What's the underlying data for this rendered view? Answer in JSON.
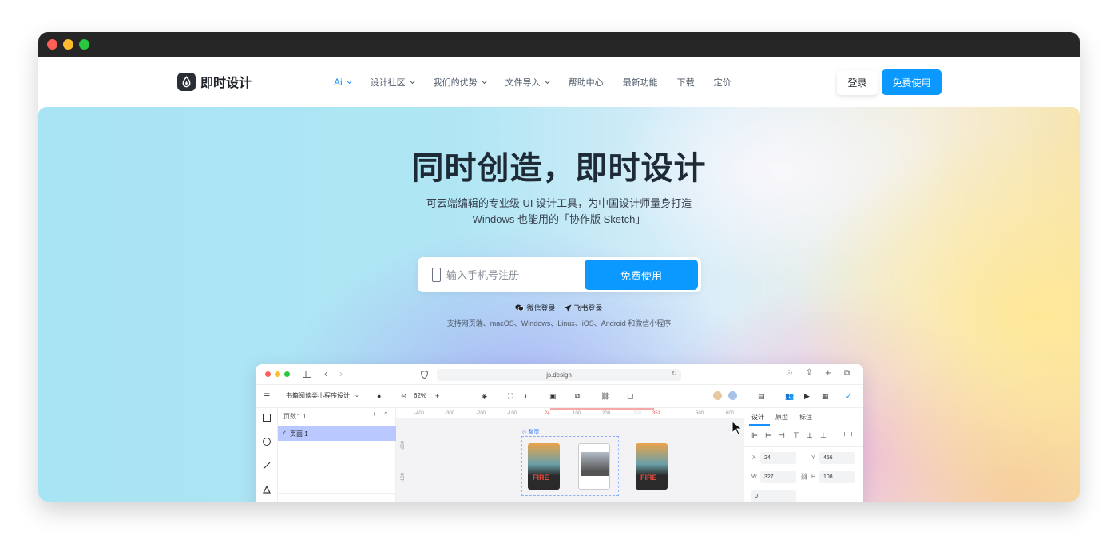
{
  "brand": {
    "name": "即时设计"
  },
  "nav": {
    "items": [
      {
        "label": "Ai",
        "dropdown": true,
        "active": true
      },
      {
        "label": "设计社区",
        "dropdown": true
      },
      {
        "label": "我们的优势",
        "dropdown": true
      },
      {
        "label": "文件导入",
        "dropdown": true
      },
      {
        "label": "帮助中心"
      },
      {
        "label": "最新功能"
      },
      {
        "label": "下载"
      },
      {
        "label": "定价"
      }
    ],
    "login_label": "登录",
    "free_label": "免费使用"
  },
  "hero": {
    "title": "同时创造，即时设计",
    "subtitle_line1": "可云端编辑的专业级 UI 设计工具，为中国设计师量身打造",
    "subtitle_line2": "Windows 也能用的「协作版 Sketch」",
    "phone_placeholder": "输入手机号注册",
    "signup_button": "免费使用",
    "wechat_login": "微信登录",
    "feishu_login": "飞书登录",
    "platforms": "支持网页端、macOS、Windows、Linux、iOS、Android 和微信小程序"
  },
  "app_preview": {
    "url": "js.design",
    "file_name": "书籍阅读类小程序设计",
    "zoom": "62%",
    "pages_label": "页数：1",
    "page_item": "页面 1",
    "frame_label": "整页",
    "ruler_ticks": [
      "-400",
      "-300",
      "-200",
      "-100",
      "24",
      "100",
      "200",
      "300",
      "351",
      "500",
      "600"
    ],
    "v_ruler": [
      "-200",
      "-100"
    ],
    "tabs": [
      "设计",
      "原型",
      "标注"
    ],
    "fields": {
      "x_label": "X",
      "x": "24",
      "y_label": "Y",
      "y": "456",
      "w_label": "W",
      "w": "327",
      "h_label": "H",
      "h": "108",
      "rot": "0"
    },
    "poster_text": "FIRE"
  },
  "colors": {
    "accent": "#0b99ff",
    "titlebar": "#262626"
  }
}
